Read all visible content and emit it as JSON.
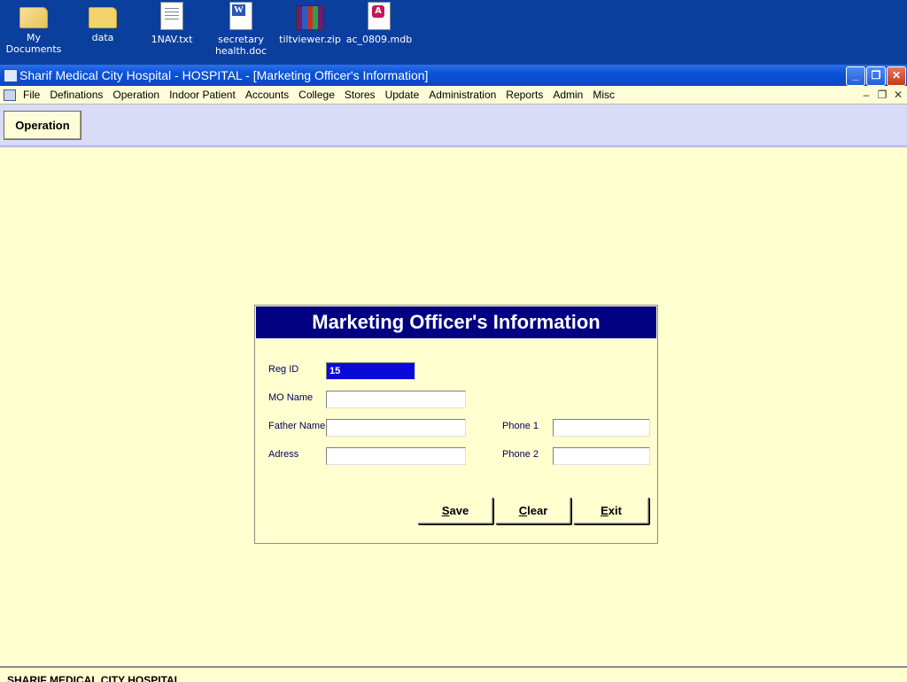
{
  "desktop": {
    "icons": [
      {
        "label": "My Documents",
        "icon": "folder-open-icon"
      },
      {
        "label": "data",
        "icon": "folder-icon"
      },
      {
        "label": "1NAV.txt",
        "icon": "text-file-icon"
      },
      {
        "label": "secretary health.doc",
        "icon": "word-doc-icon"
      },
      {
        "label": "tiltviewer.zip",
        "icon": "zip-archive-icon"
      },
      {
        "label": "ac_0809.mdb",
        "icon": "access-db-icon"
      }
    ]
  },
  "window": {
    "title": "Sharif Medical City Hospital - HOSPITAL - [Marketing Officer's Information]",
    "controls": {
      "minimize": "_",
      "restore": "❐",
      "close": "✕"
    }
  },
  "menu": {
    "items": [
      "File",
      "Definations",
      "Operation",
      "Indoor Patient",
      "Accounts",
      "College",
      "Stores",
      "Update",
      "Administration",
      "Reports",
      "Admin",
      "Misc"
    ],
    "mdi_controls": {
      "minimize": "–",
      "restore": "❐",
      "close": "✕"
    }
  },
  "toolbar": {
    "operation_label": "Operation"
  },
  "form": {
    "title": "Marketing Officer's Information",
    "fields": {
      "reg_id": {
        "label": "Reg ID",
        "value": "15"
      },
      "mo_name": {
        "label": "MO Name",
        "value": ""
      },
      "father_name": {
        "label": "Father Name",
        "value": ""
      },
      "address": {
        "label": "Adress",
        "value": ""
      },
      "phone1": {
        "label": "Phone 1",
        "value": ""
      },
      "phone2": {
        "label": "Phone 2",
        "value": ""
      }
    },
    "buttons": {
      "save": {
        "hotkey": "S",
        "rest": "ave"
      },
      "clear": {
        "hotkey": "C",
        "rest": "lear"
      },
      "exit": {
        "hotkey": "E",
        "rest": "xit"
      }
    }
  },
  "statusbar": {
    "text": "SHARIF MEDICAL CITY HOSPITAL"
  },
  "colors": {
    "form_header": "#000080",
    "client_bg": "#ffffcf",
    "toolbar_bg": "#d9dcf6",
    "selected_field": "#0a0ad8"
  }
}
